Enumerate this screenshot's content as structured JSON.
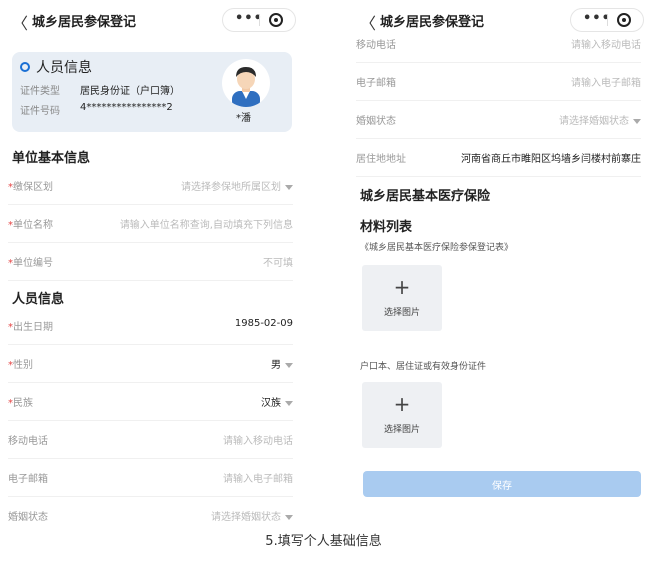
{
  "nav": {
    "title": "城乡居民参保登记",
    "back_glyph": "〈",
    "more_glyph": "•••"
  },
  "left": {
    "card": {
      "title": "人员信息",
      "id_type_label": "证件类型",
      "id_type_value": "居民身份证（户口簿）",
      "id_no_label": "证件号码",
      "id_no_value": "4****************2",
      "name": "*潘"
    },
    "unit_section": "单位基本信息",
    "unit_rows": [
      {
        "label": "缴保区划",
        "value": "请选择参保地所属区划",
        "required": true,
        "dropdown": true
      },
      {
        "label": "单位名称",
        "value": "请输入单位名称查询,自动填充下列信息",
        "required": true,
        "dropdown": false
      },
      {
        "label": "单位编号",
        "value": "不可填",
        "required": true,
        "dropdown": false
      }
    ],
    "person_section": "人员信息",
    "person_rows": [
      {
        "label": "出生日期",
        "value": "1985-02-09",
        "required": true,
        "dropdown": false,
        "filled": true
      },
      {
        "label": "性别",
        "value": "男",
        "required": true,
        "dropdown": true,
        "filled": true
      },
      {
        "label": "民族",
        "value": "汉族",
        "required": true,
        "dropdown": true,
        "filled": true
      },
      {
        "label": "移动电话",
        "value": "请输入移动电话",
        "required": false,
        "dropdown": false,
        "filled": false
      },
      {
        "label": "电子邮箱",
        "value": "请输入电子邮箱",
        "required": false,
        "dropdown": false,
        "filled": false
      },
      {
        "label": "婚姻状态",
        "value": "请选择婚姻状态",
        "required": false,
        "dropdown": true,
        "filled": false
      }
    ]
  },
  "right": {
    "rows": [
      {
        "label": "移动电话",
        "value": "请输入移动电话",
        "dropdown": false,
        "filled": false
      },
      {
        "label": "电子邮箱",
        "value": "请输入电子邮箱",
        "dropdown": false,
        "filled": false
      },
      {
        "label": "婚姻状态",
        "value": "请选择婚姻状态",
        "dropdown": true,
        "filled": false
      },
      {
        "label": "居住地地址",
        "value": "河南省商丘市睢阳区坞墙乡闫楼村前寨庄",
        "dropdown": false,
        "filled": true
      }
    ],
    "insurance_title": "城乡居民基本医疗保险",
    "materials_title": "材料列表",
    "material1_label": "《城乡居民基本医疗保险参保登记表》",
    "upload1_label": "选择图片",
    "material2_label": "户口本、居住证或有效身份证件",
    "upload2_label": "选择图片",
    "save_label": "保存"
  },
  "caption": "5.填写个人基础信息",
  "colors": {
    "accent": "#1a6fd4",
    "save_button": "#a9cbf0",
    "required": "#e54545",
    "card_bg": "#e8eef5"
  }
}
